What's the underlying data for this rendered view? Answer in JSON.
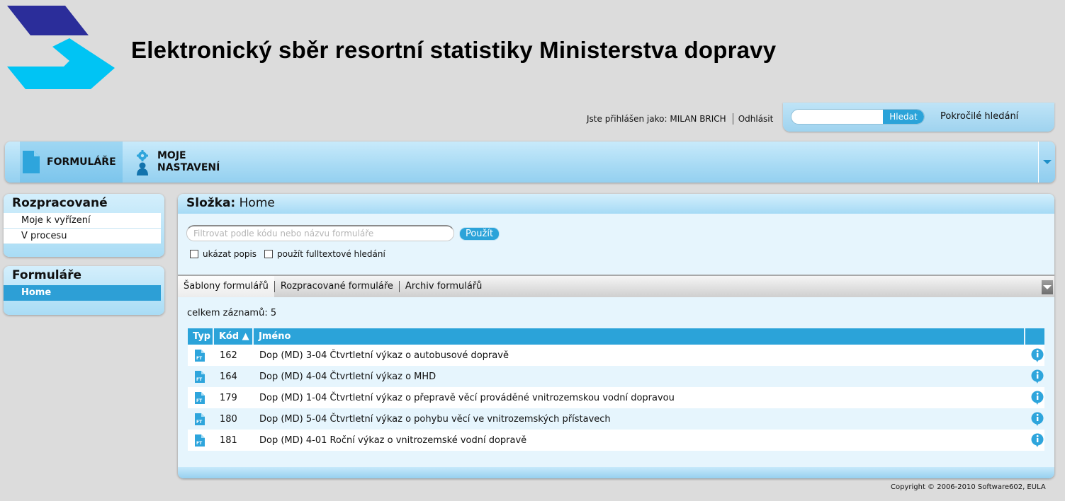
{
  "header": {
    "title": "Elektronický sběr resortní statistiky Ministerstva dopravy",
    "logo_colors": [
      "#2b2d9a",
      "#00c4f4"
    ]
  },
  "user": {
    "logged_as": "Jste přihlášen jako: MILAN BRICH",
    "logout": "Odhlásit"
  },
  "search": {
    "value": "",
    "button": "Hledat",
    "advanced": "Pokročilé hledání"
  },
  "nav": {
    "forms": "FORMULÁŘE",
    "settings": "MOJE NASTAVENÍ",
    "icons": [
      "document-icon",
      "gear-person-icon",
      "chevron-down-icon"
    ]
  },
  "sidebar": {
    "wip": {
      "title": "Rozpracované",
      "items": [
        {
          "label": "Moje k vyřízení"
        },
        {
          "label": "V procesu"
        }
      ]
    },
    "forms": {
      "title": "Formuláře",
      "items": [
        {
          "label": "Home",
          "active": true
        }
      ]
    }
  },
  "main": {
    "folder_label": "Složka:",
    "folder_name": "Home",
    "filter_placeholder": "Filtrovat podle kódu nebo názvu formuláře",
    "apply": "Použít",
    "show_desc": "ukázat popis",
    "fulltext": "použít fulltextové hledání",
    "tabs": [
      {
        "label": "Šablony formulářů",
        "active": true
      },
      {
        "label": "Rozpracované formuláře"
      },
      {
        "label": "Archiv formulářů"
      }
    ],
    "total": "celkem záznamů: 5",
    "columns": {
      "typ": "Typ",
      "kod": "Kód ▲",
      "jmeno": "Jméno"
    },
    "rows": [
      {
        "code": "162",
        "name": "Dop (MD) 3-04 Čtvrtletní výkaz o autobusové dopravě"
      },
      {
        "code": "164",
        "name": "Dop (MD) 4-04 Čtvrtletní výkaz o MHD"
      },
      {
        "code": "179",
        "name": "Dop (MD) 1-04 Čtvrtletní výkaz o přepravě věcí prováděné vnitrozemskou vodní dopravou"
      },
      {
        "code": "180",
        "name": "Dop (MD) 5-04 Čtvrtletní výkaz o pohybu věcí ve vnitrozemských přístavech"
      },
      {
        "code": "181",
        "name": "Dop (MD) 4-01 Roční výkaz o vnitrozemské vodní dopravě"
      }
    ]
  },
  "footer": {
    "copyright": "Copyright © 2006-2010 Software602, EULA"
  },
  "colors": {
    "accent": "#2ba3d9",
    "panel_bg": "#e6f5fd",
    "page_bg": "#dcdcdc"
  }
}
